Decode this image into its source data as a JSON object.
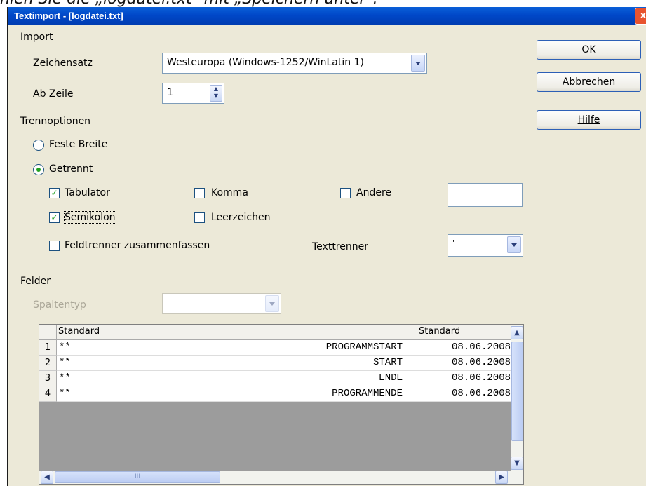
{
  "doc_text": "hlen Sie die „logdatei.txt\" mit „Speichern unter\".",
  "window": {
    "title": "Textimport - [logdatei.txt]",
    "close": "x"
  },
  "buttons": {
    "ok": "OK",
    "cancel": "Abbrechen",
    "help": "Hilfe"
  },
  "import_group": {
    "label": "Import",
    "charset_label": "Zeichensatz",
    "charset_value": "Westeuropa (Windows-1252/WinLatin 1)",
    "from_row_label": "Ab Zeile",
    "from_row_value": "1"
  },
  "separator_group": {
    "label": "Trennoptionen",
    "fixed_width": "Feste Breite",
    "separated": "Getrennt",
    "separated_selected": true,
    "tab": {
      "label": "Tabulator",
      "checked": true
    },
    "comma": {
      "label": "Komma",
      "checked": false
    },
    "other": {
      "label": "Andere",
      "checked": false,
      "value": ""
    },
    "semicolon": {
      "label": "Semikolon",
      "checked": true
    },
    "space": {
      "label": "Leerzeichen",
      "checked": false
    },
    "merge": {
      "label": "Feldtrenner zusammenfassen",
      "checked": false
    },
    "text_delimiter_label": "Texttrenner",
    "text_delimiter_value": "\""
  },
  "fields_group": {
    "label": "Felder",
    "column_type_label": "Spaltentyp",
    "column_type_value": ""
  },
  "grid": {
    "headers": [
      "Standard",
      "Standard"
    ],
    "rows": [
      {
        "num": "1",
        "col1_left": "**",
        "col1_right": "PROGRAMMSTART",
        "col2": "08.06.2008"
      },
      {
        "num": "2",
        "col1_left": "**",
        "col1_right": "START",
        "col2": "08.06.2008"
      },
      {
        "num": "3",
        "col1_left": "**",
        "col1_right": "ENDE",
        "col2": "08.06.2008"
      },
      {
        "num": "4",
        "col1_left": "**",
        "col1_right": "PROGRAMMENDE",
        "col2": "08.06.2008"
      }
    ],
    "scroll_up_icon": "▲",
    "scroll_down_icon": "▼",
    "scroll_left_icon": "◀",
    "scroll_right_icon": "▶",
    "hscroll_grip": "III"
  }
}
